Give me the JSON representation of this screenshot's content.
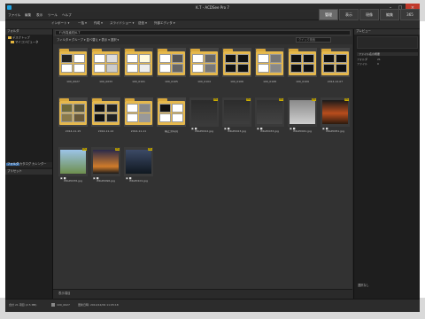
{
  "window": {
    "title": "K.T - ACDSee Pro 7",
    "modes": [
      "管理",
      "表示",
      "現像",
      "編集",
      "365"
    ],
    "active_mode": 0
  },
  "menu": [
    "ファイル",
    "編集",
    "表示",
    "ツール",
    "ヘルプ"
  ],
  "toolbar": [
    "インポート ▾",
    "一括 ▾",
    "作成 ▾",
    "スライドショー ▾",
    "送信 ▾",
    "外部エディタ ▾"
  ],
  "left_panel": {
    "header": "フォルダ",
    "tree": [
      "デスクトップ",
      "マイコンピュータ"
    ],
    "tabs": [
      "フォルダ",
      "カタログ",
      "カレンダー"
    ],
    "lower_header": "プリセット"
  },
  "location_bar": "F:\\写真素材\\K.T",
  "breadcrumb": "フィルタ ▾  グループ ▾  並べ替え ▾  表示 ▾  選択 ▾",
  "search_placeholder": "クイック検索",
  "thumbnails": [
    {
      "caption": "100_0027",
      "kind": "folder"
    },
    {
      "caption": "100_0033",
      "kind": "folder"
    },
    {
      "caption": "100_0101",
      "kind": "folder"
    },
    {
      "caption": "100_0105",
      "kind": "folder"
    },
    {
      "caption": "100_0104",
      "kind": "folder"
    },
    {
      "caption": "100_0106",
      "kind": "folder"
    },
    {
      "caption": "100_0108",
      "kind": "folder"
    },
    {
      "caption": "100_0109",
      "kind": "folder"
    },
    {
      "caption": "2014-12-07",
      "kind": "folder"
    },
    {
      "caption": "2014-11-15",
      "kind": "folder"
    },
    {
      "caption": "2014-11-14",
      "kind": "folder"
    },
    {
      "caption": "2014-11-11",
      "kind": "folder"
    },
    {
      "caption": "補正済写真",
      "kind": "folder"
    },
    {
      "caption": "IMGP0012.jpg",
      "kind": "photo",
      "badge": "JPG"
    },
    {
      "caption": "IMGP0023.jpg",
      "kind": "photo",
      "badge": "JPG"
    },
    {
      "caption": "IMGP0033.jpg",
      "kind": "photo",
      "badge": "JPG"
    },
    {
      "caption": "IMGP0041.jpg",
      "kind": "photo",
      "badge": "JPG"
    },
    {
      "caption": "IMGP0051.jpg",
      "kind": "photo",
      "badge": "JPG"
    },
    {
      "caption": "IMGP0076.jpg",
      "kind": "photo",
      "badge": "JPG"
    },
    {
      "caption": "IMGP0096.jpg",
      "kind": "photo",
      "badge": "JPG"
    },
    {
      "caption": "IMGP0101.jpg",
      "kind": "photo",
      "badge": "JPG"
    }
  ],
  "right_panel": {
    "header": "プレビュー",
    "section": "ファイル名の概要",
    "fields": [
      {
        "label": "フォルダ",
        "value": "21"
      },
      {
        "label": "ファイル",
        "value": "0"
      }
    ],
    "bottom": "選択なし"
  },
  "center_bottom": "表示項目",
  "status": {
    "total": "合計 21 項目 (2.5 MB)",
    "selected": "100_0027",
    "modified": "更新日時: 2014/12/09 11:05:18"
  }
}
